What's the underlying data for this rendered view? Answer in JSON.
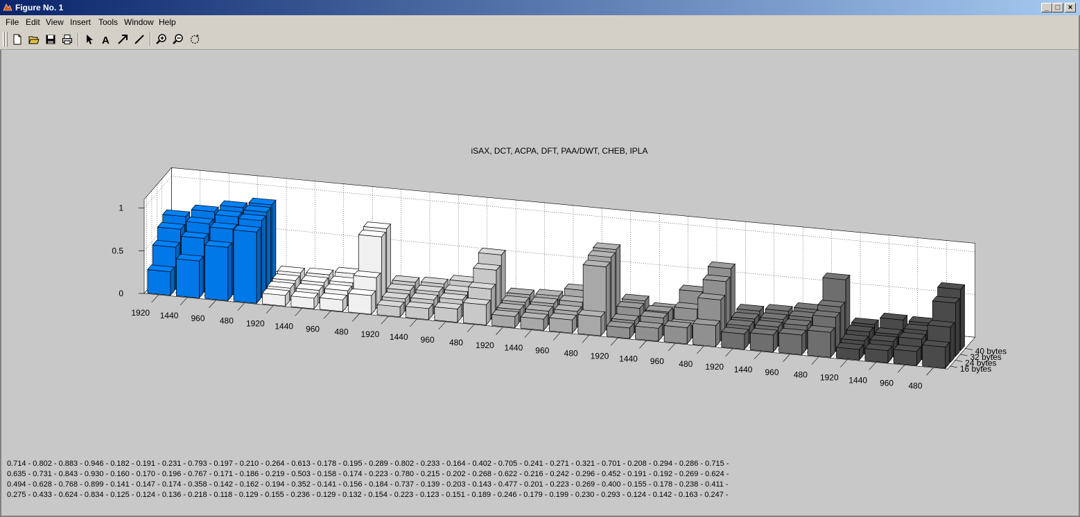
{
  "window": {
    "title": "Figure No. 1",
    "controls": {
      "minimize": "_",
      "maximize": "□",
      "close": "×"
    }
  },
  "menu": [
    "File",
    "Edit",
    "View",
    "Insert",
    "Tools",
    "Window",
    "Help"
  ],
  "toolbar_icons": [
    "new-file-icon",
    "open-file-icon",
    "save-icon",
    "print-icon",
    "select-arrow-icon",
    "text-insert-icon",
    "arrow-insert-icon",
    "line-insert-icon",
    "zoom-in-icon",
    "zoom-out-icon",
    "rotate-icon"
  ],
  "colors": {
    "highlight": "#0078e8",
    "groups": [
      "#f0f0f0",
      "#c8c8c8",
      "#a8a8a8",
      "#909090",
      "#6e6e6e",
      "#4a4a4a"
    ]
  },
  "chart_data": {
    "type": "bar3d",
    "title": "iSAX, DCT, ACPA, DFT, PAA/DWT, CHEB, IPLA",
    "z_ticks": [
      "0",
      "0.5",
      "1"
    ],
    "zlim": [
      0,
      1.1
    ],
    "x_tick_labels": [
      "1920",
      "1440",
      "960",
      "480",
      "1920",
      "1440",
      "960",
      "480",
      "1920",
      "1440",
      "960",
      "480",
      "1920",
      "1440",
      "960",
      "480",
      "1920",
      "1440",
      "960",
      "480",
      "1920",
      "1440",
      "960",
      "480",
      "1920",
      "1440",
      "960",
      "480"
    ],
    "y_tick_labels": [
      "40 bytes",
      "32 bytes",
      "24 bytes",
      "16 bytes"
    ],
    "grid": true,
    "series": [
      {
        "name": "40 bytes",
        "values": [
          0.714,
          0.802,
          0.883,
          0.946,
          0.182,
          0.191,
          0.231,
          0.793,
          0.197,
          0.21,
          0.264,
          0.613,
          0.178,
          0.195,
          0.289,
          0.802,
          0.233,
          0.164,
          0.402,
          0.705,
          0.241,
          0.271,
          0.321,
          0.701,
          0.208,
          0.294,
          0.286,
          0.715
        ]
      },
      {
        "name": "32 bytes",
        "values": [
          0.635,
          0.731,
          0.843,
          0.93,
          0.16,
          0.17,
          0.196,
          0.767,
          0.171,
          0.186,
          0.219,
          0.503,
          0.158,
          0.174,
          0.223,
          0.78,
          0.215,
          0.202,
          0.268,
          0.622,
          0.216,
          0.242,
          0.296,
          0.452,
          0.191,
          0.192,
          0.269,
          0.624
        ]
      },
      {
        "name": "24 bytes",
        "values": [
          0.494,
          0.628,
          0.768,
          0.899,
          0.141,
          0.147,
          0.174,
          0.358,
          0.142,
          0.162,
          0.194,
          0.352,
          0.141,
          0.156,
          0.184,
          0.737,
          0.139,
          0.203,
          0.143,
          0.477,
          0.201,
          0.223,
          0.269,
          0.4,
          0.155,
          0.178,
          0.238,
          0.411
        ]
      },
      {
        "name": "16 bytes",
        "values": [
          0.275,
          0.433,
          0.624,
          0.834,
          0.125,
          0.124,
          0.136,
          0.218,
          0.118,
          0.129,
          0.155,
          0.236,
          0.129,
          0.132,
          0.154,
          0.223,
          0.123,
          0.151,
          0.189,
          0.246,
          0.179,
          0.199,
          0.23,
          0.293,
          0.124,
          0.142,
          0.163,
          0.247
        ]
      }
    ]
  },
  "data_lines": [
    "0.714 - 0.802 - 0.883 - 0.946 - 0.182 - 0.191 - 0.231 - 0.793 - 0.197 - 0.210 - 0.264 - 0.613 - 0.178 - 0.195 - 0.289 - 0.802 - 0.233 - 0.164 - 0.402 - 0.705 - 0.241 - 0.271 - 0.321 - 0.701 - 0.208 - 0.294 - 0.286 - 0.715 -",
    "0.635 - 0.731 - 0.843 - 0.930 - 0.160 - 0.170 - 0.196 - 0.767 - 0.171 - 0.186 - 0.219 - 0.503 - 0.158 - 0.174 - 0.223 - 0.780 - 0.215 - 0.202 - 0.268 - 0.622 - 0.216 - 0.242 - 0.296 - 0.452 - 0.191 - 0.192 - 0.269 - 0.624 -",
    "0.494 - 0.628 - 0.768 - 0.899 - 0.141 - 0.147 - 0.174 - 0.358 - 0.142 - 0.162 - 0.194 - 0.352 - 0.141 - 0.156 - 0.184 - 0.737 - 0.139 - 0.203 - 0.143 - 0.477 - 0.201 - 0.223 - 0.269 - 0.400 - 0.155 - 0.178 - 0.238 - 0.411 -",
    "0.275 - 0.433 - 0.624 - 0.834 - 0.125 - 0.124 - 0.136 - 0.218 - 0.118 - 0.129 - 0.155 - 0.236 - 0.129 - 0.132 - 0.154 - 0.223 - 0.123 - 0.151 - 0.189 - 0.246 - 0.179 - 0.199 - 0.230 - 0.293 - 0.124 - 0.142 - 0.163 - 0.247 -"
  ]
}
